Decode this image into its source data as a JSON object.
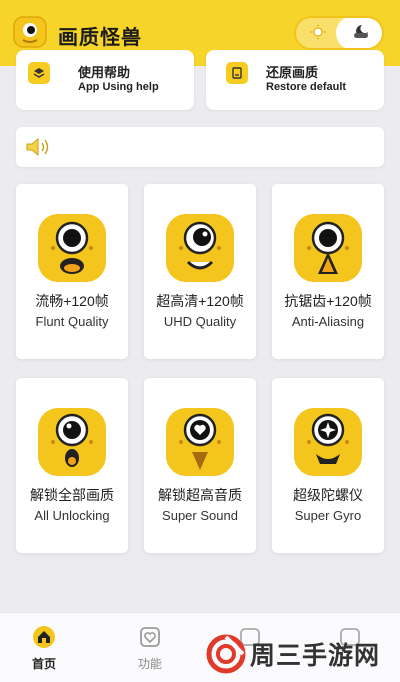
{
  "header": {
    "title": "画质怪兽",
    "toggle_state": "light"
  },
  "top_cards": [
    {
      "title": "使用帮助",
      "subtitle": "App Using help",
      "icon": "layers-icon"
    },
    {
      "title": "还原画质",
      "subtitle": "Restore default",
      "icon": "restore-icon"
    }
  ],
  "notice": {
    "icon": "speaker-icon",
    "text": ""
  },
  "features": [
    {
      "title": "流畅+120帧",
      "subtitle": "Flunt Quality"
    },
    {
      "title": "超高清+120帧",
      "subtitle": "UHD Quality"
    },
    {
      "title": "抗锯齿+120帧",
      "subtitle": "Anti-Aliasing"
    },
    {
      "title": "解锁全部画质",
      "subtitle": "All Unlocking"
    },
    {
      "title": "解锁超高音质",
      "subtitle": "Super Sound"
    },
    {
      "title": "超级陀螺仪",
      "subtitle": "Super Gyro"
    }
  ],
  "tabs": [
    {
      "label": "首页",
      "icon": "home-icon",
      "active": true
    },
    {
      "label": "功能",
      "icon": "heart-card-icon",
      "active": false
    }
  ],
  "watermark": {
    "text": "周三手游网"
  },
  "colors": {
    "brand_yellow": "#f6d42a",
    "mascot_yellow": "#f4c51c",
    "background": "#ececf0"
  }
}
